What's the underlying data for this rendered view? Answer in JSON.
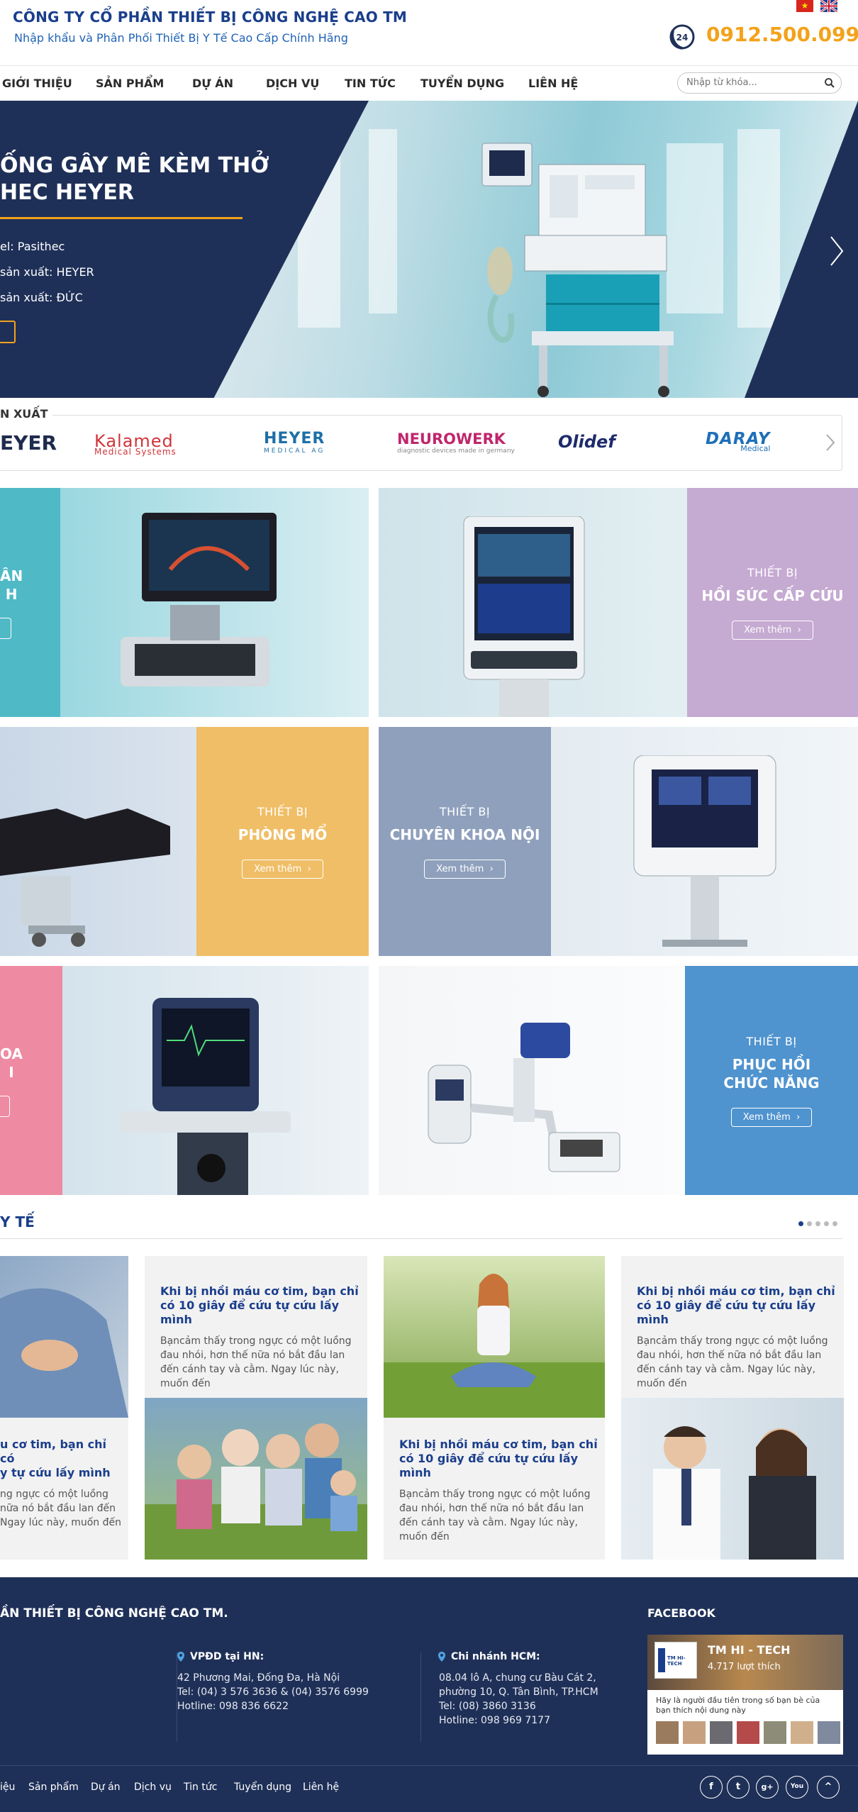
{
  "header": {
    "company": "CÔNG TY CỔ PHẦN THIẾT BỊ CÔNG NGHỆ CAO TM",
    "slogan": "Nhập khẩu và Phân Phối Thiết Bị Y Tế Cao Cấp Chính Hãng",
    "hotline": "0912.500.099",
    "phone_badge": "24"
  },
  "nav": {
    "items": [
      "GIỚI THIỆU",
      "SẢN PHẨM",
      "DỰ ÁN",
      "DỊCH VỤ",
      "TIN TỨC",
      "TUYỂN DỤNG",
      "LIÊN HỆ"
    ],
    "search_placeholder": "Nhập từ khóa..."
  },
  "hero": {
    "title_line1": "ỐNG GÂY MÊ KÈM THỞ",
    "title_line2": "HEC HEYER",
    "spec1": "el: Pasithec",
    "spec2": " sản xuất: HEYER",
    "spec3": " sản xuất: ĐỨC"
  },
  "brands": {
    "title": "N XUẤT",
    "items": [
      "EYER",
      "Kalamed",
      "Medical Systems",
      "HEYER",
      "MEDICAL AG",
      "NEUROWERK",
      "diagnostic devices made in germany",
      "Olidef",
      "DARAY",
      "Medical"
    ]
  },
  "categories": {
    "sub": "THIẾT BỊ",
    "more": "Xem thêm",
    "left1_partial": [
      "ÂN",
      "H"
    ],
    "hoi_suc": "HỒI SỨC CẤP CỨU",
    "phong_mo": "PHÒNG MỔ",
    "khoa_noi": "CHUYÊN KHOA NỘI",
    "left3_partial": [
      "OA",
      "I"
    ],
    "phuc_hoi_1": "PHỤC HỒI",
    "phuc_hoi_2": "CHỨC NĂNG"
  },
  "news": {
    "title": "Y TẾ",
    "headline": "Khi bị nhồi máu cơ tim, bạn chỉ có 10 giây để cứu tự cứu lấy mình",
    "body": "Bạncảm thấy trong ngực có một luồng đau nhói, hơn thế nữa nó bắt đầu lan đến cánh tay và cằm. Ngay lúc này, muốn đến",
    "partial_headline_1": "u cơ tim, bạn chỉ có",
    "partial_headline_2": "y tự cứu lấy mình",
    "partial_body_1": "ng ngực có một luồng",
    "partial_body_2": "nữa nó bắt đầu lan đến",
    "partial_body_3": "Ngay lúc này, muốn đến"
  },
  "footer": {
    "company": "ẦN THIẾT BỊ CÔNG NGHỆ CAO TM.",
    "hn_title": "VPĐD tại HN:",
    "hn_lines": [
      "42 Phương Mai, Đống Đa, Hà Nội",
      "Tel: (04) 3 576 3636 & (04) 3576 6999",
      "Hotline: 098 836 6622"
    ],
    "hcm_title": "Chi nhánh HCM:",
    "hcm_lines": [
      "08.04 lô A, chung cư Bàu Cát 2,",
      "phường 10, Q. Tân Bình, TP.HCM",
      "Tel: (08) 3860 3136",
      "Hotline: 098 969 7177"
    ],
    "links": [
      "iệu",
      "Sản phẩm",
      "Dự án",
      "Dịch vụ",
      "Tin tức",
      "Tuyển dụng",
      "Liên hệ"
    ],
    "social": [
      "f",
      "t",
      "g+",
      "You",
      "^"
    ],
    "facebook_title": "FACEBOOK",
    "fb_name": "TM HI - TECH",
    "fb_likes": "4.717 lượt thích",
    "fb_text": "Hãy là người đầu tiên trong số bạn bè của bạn thích nội dung này",
    "fb_logo": "TM HI-TECH"
  }
}
